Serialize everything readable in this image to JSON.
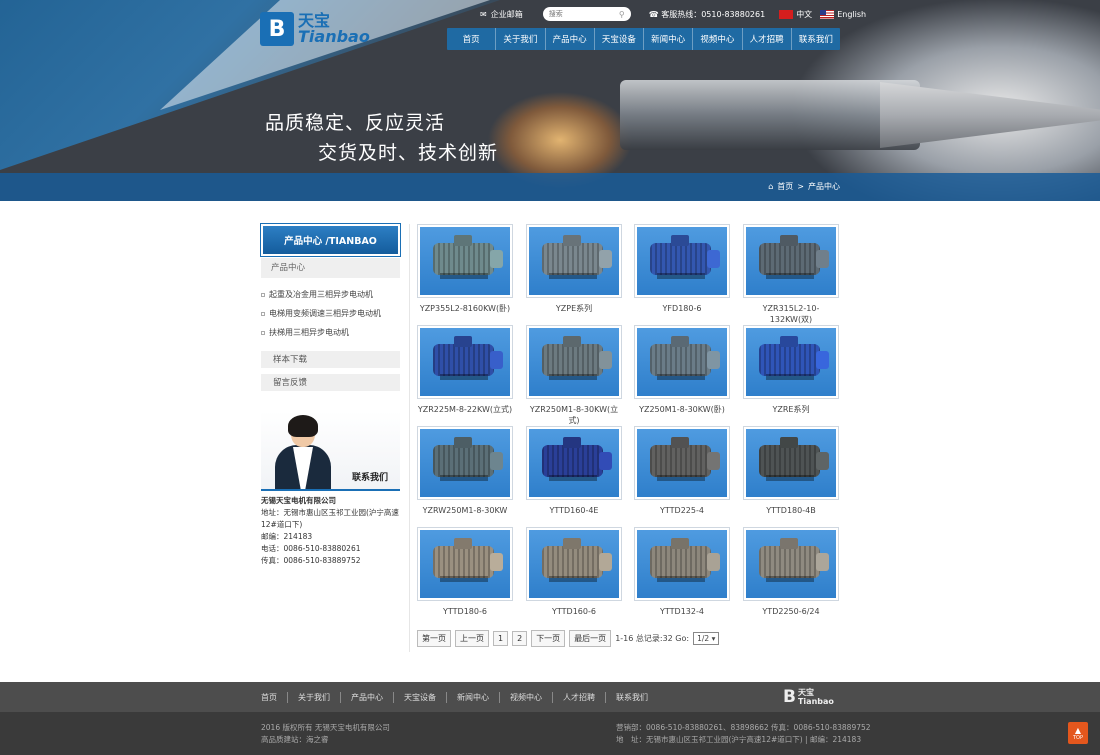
{
  "header": {
    "logo_cn": "天宝",
    "logo_en": "Tianbao",
    "mail_label": "企业邮箱",
    "search_placeholder": "搜索",
    "hotline": "客服热线：0510-83880261",
    "lang_cn": "中文",
    "lang_en": "English",
    "nav": [
      "首页",
      "关于我们",
      "产品中心",
      "天宝设备",
      "新闻中心",
      "视频中心",
      "人才招聘",
      "联系我们"
    ]
  },
  "banner": {
    "slogan_line1": "品质稳定、反应灵活",
    "slogan_line2": "交货及时、技术创新"
  },
  "breadcrumb": {
    "home": "首页",
    "current": "产品中心"
  },
  "sidebar": {
    "title": "产品中心 /TIANBAO",
    "category": "产品中心",
    "subitems": [
      "起重及冶金用三相异步电动机",
      "电梯用变频调速三相异步电动机",
      "扶梯用三相异步电动机"
    ],
    "extra": [
      "样本下载",
      "留言反馈"
    ],
    "contact_label": "联系我们",
    "company": "无锡天宝电机有限公司",
    "address": "地址：无锡市惠山区玉祁工业园(沪宁高速12#道口下)",
    "postcode": "邮编：214183",
    "phone": "电话：0086-510-83880261",
    "fax": "传真：0086-510-83889752"
  },
  "products": [
    {
      "name": "YZP355L2-8160KW(卧)",
      "color": "#6f8a8d",
      "bg": "#4f9be0"
    },
    {
      "name": "YZPE系列",
      "color": "#7a878e",
      "bg": "#4f9be0"
    },
    {
      "name": "YFD180-6",
      "color": "#3357b0",
      "bg": "#4f9be0"
    },
    {
      "name": "YZR315L2-10-132KW(双)",
      "color": "#5d6a74",
      "bg": "#4f9be0"
    },
    {
      "name": "YZR225M-8-22KW(立式)",
      "color": "#2f4fa8",
      "bg": "#4f9be0"
    },
    {
      "name": "YZR250M1-8-30KW(立式)",
      "color": "#6c7a80",
      "bg": "#4f9be0"
    },
    {
      "name": "YZ250M1-8-30KW(卧)",
      "color": "#6a7c88",
      "bg": "#4f9be0"
    },
    {
      "name": "YZRE系列",
      "color": "#2f55b8",
      "bg": "#4f9be0"
    },
    {
      "name": "YZRW250M1-8-30KW",
      "color": "#5b6f77",
      "bg": "#4f9be0"
    },
    {
      "name": "YTTD160-4E",
      "color": "#2a3f98",
      "bg": "#4f9be0"
    },
    {
      "name": "YTTD225-4",
      "color": "#616160",
      "bg": "#4f9be0"
    },
    {
      "name": "YTTD180-4B",
      "color": "#4e5354",
      "bg": "#4f9be0"
    },
    {
      "name": "YTTD180-6",
      "color": "#9a9080",
      "bg": "#4f9be0"
    },
    {
      "name": "YTTD160-6",
      "color": "#948c7e",
      "bg": "#4f9be0"
    },
    {
      "name": "YTTD132-4",
      "color": "#8d877c",
      "bg": "#4f9be0"
    },
    {
      "name": "YTD2250-6/24",
      "color": "#8f8a80",
      "bg": "#4f9be0"
    }
  ],
  "pager": {
    "first": "第一页",
    "prev": "上一页",
    "page1": "1",
    "page2": "2",
    "next": "下一页",
    "last": "最后一页",
    "summary": "1-16 总记录:32 Go:",
    "select_value": "1/2"
  },
  "footer": {
    "links": [
      "首页",
      "关于我们",
      "产品中心",
      "天宝设备",
      "新闻中心",
      "视频中心",
      "人才招聘",
      "联系我们"
    ],
    "logo_cn": "天宝",
    "logo_en": "Tianbao",
    "copyright": "2016 版权所有 无锡天宝电机有限公司",
    "builder": "高品质建站：海之睿",
    "sales": "营销部：0086-510-83880261、83898662 传真：0086-510-83889752",
    "address": "地　址：无锡市惠山区玉祁工业园(沪宁高速12#道口下) | 邮编：214183",
    "top_label": "TOP"
  },
  "colors": {
    "brand": "#1a6fb5",
    "top_button": "#e4571d"
  }
}
